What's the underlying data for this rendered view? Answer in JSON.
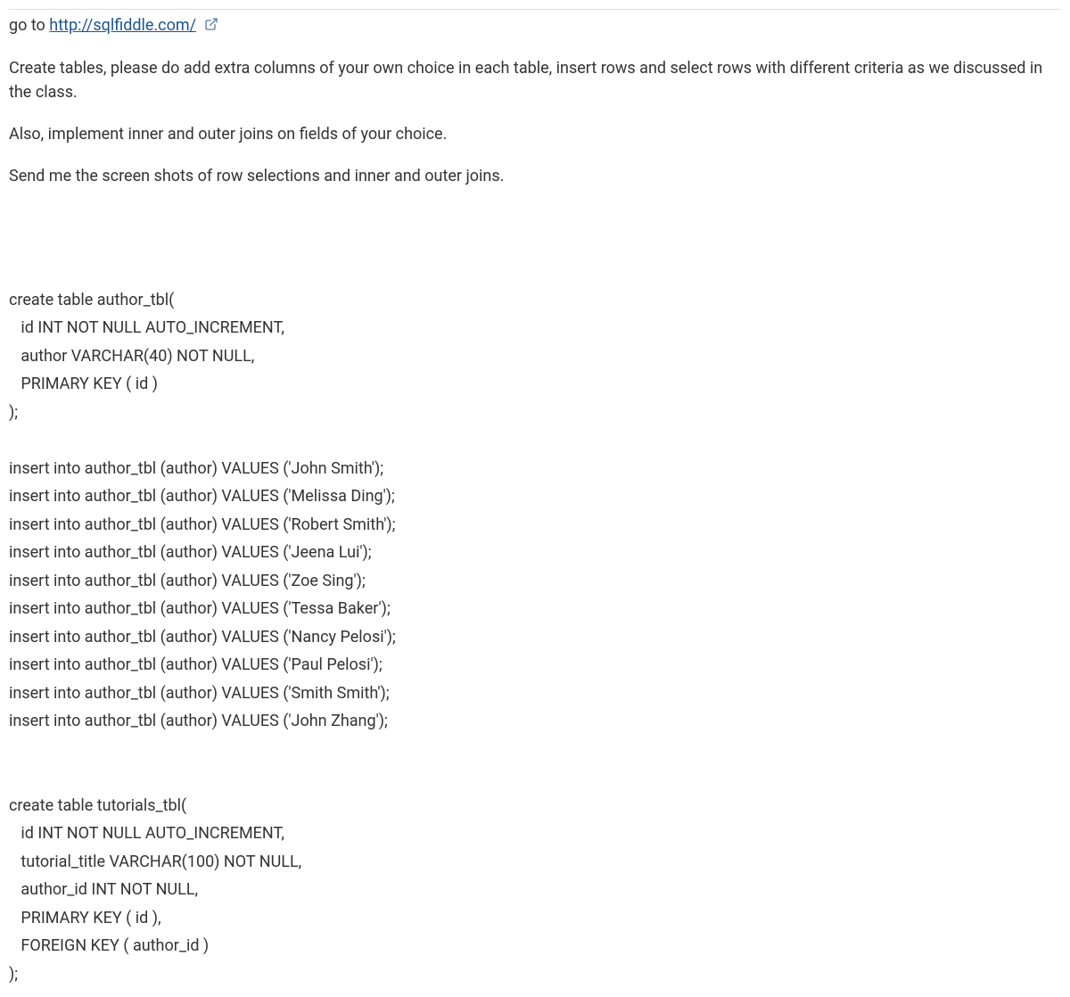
{
  "intro": {
    "prefix": "go to ",
    "link_text": "http://sqlfiddle.com/",
    "link_href": "http://sqlfiddle.com/"
  },
  "paragraphs": [
    "Create tables, please do add extra columns of your own choice in each table, insert rows and select rows with different criteria as we discussed in the class.",
    "Also, implement inner and outer joins on fields of your choice.",
    "Send me the screen shots of row selections and inner and outer joins."
  ],
  "sql": "create table author_tbl(\n   id INT NOT NULL AUTO_INCREMENT,\n   author VARCHAR(40) NOT NULL,\n   PRIMARY KEY ( id )\n);\n\ninsert into author_tbl (author) VALUES ('John Smith');\ninsert into author_tbl (author) VALUES ('Melissa Ding');\ninsert into author_tbl (author) VALUES ('Robert Smith');\ninsert into author_tbl (author) VALUES ('Jeena Lui');\ninsert into author_tbl (author) VALUES ('Zoe Sing');\ninsert into author_tbl (author) VALUES ('Tessa Baker');\ninsert into author_tbl (author) VALUES ('Nancy Pelosi');\ninsert into author_tbl (author) VALUES ('Paul Pelosi');\ninsert into author_tbl (author) VALUES ('Smith Smith');\ninsert into author_tbl (author) VALUES ('John Zhang');\n\n\ncreate table tutorials_tbl(\n   id INT NOT NULL AUTO_INCREMENT,\n   tutorial_title VARCHAR(100) NOT NULL,\n   author_id INT NOT NULL,\n   PRIMARY KEY ( id ),\n   FOREIGN KEY ( author_id )\n);"
}
